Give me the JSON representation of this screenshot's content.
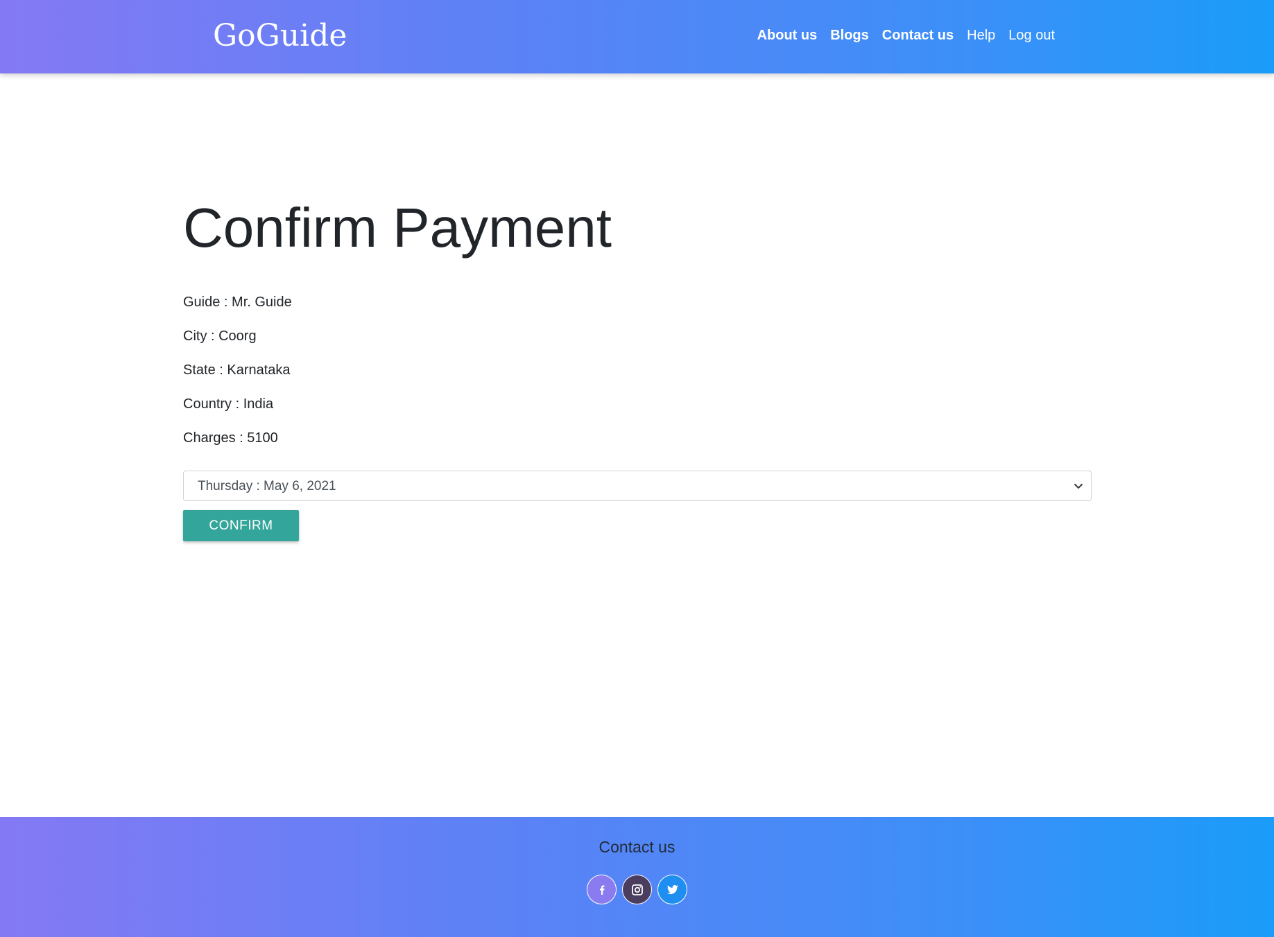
{
  "header": {
    "brand": "GoGuide",
    "nav": [
      {
        "label": "About us"
      },
      {
        "label": "Blogs"
      },
      {
        "label": "Contact us"
      },
      {
        "label": "Help"
      },
      {
        "label": "Log out"
      }
    ]
  },
  "main": {
    "title": "Confirm Payment",
    "details": [
      {
        "text": "Guide : Mr. Guide"
      },
      {
        "text": "City : Coorg"
      },
      {
        "text": "State : Karnataka"
      },
      {
        "text": "Country : India"
      },
      {
        "text": "Charges : 5100"
      }
    ],
    "date_select": {
      "selected": "Thursday : May 6, 2021",
      "icon": "chevron-down-icon"
    },
    "confirm_label": "CONFIRM"
  },
  "footer": {
    "title": "Contact us",
    "social": [
      {
        "icon": "facebook-icon",
        "color": "#8a7cf0"
      },
      {
        "icon": "instagram-icon",
        "color": "#4a3d5e"
      },
      {
        "icon": "twitter-icon",
        "color": "#1f8ef1"
      }
    ]
  },
  "colors": {
    "gradient_start": "#8479f4",
    "gradient_end": "#1a9cf9",
    "confirm_button": "#34a59a",
    "text": "#212529"
  }
}
